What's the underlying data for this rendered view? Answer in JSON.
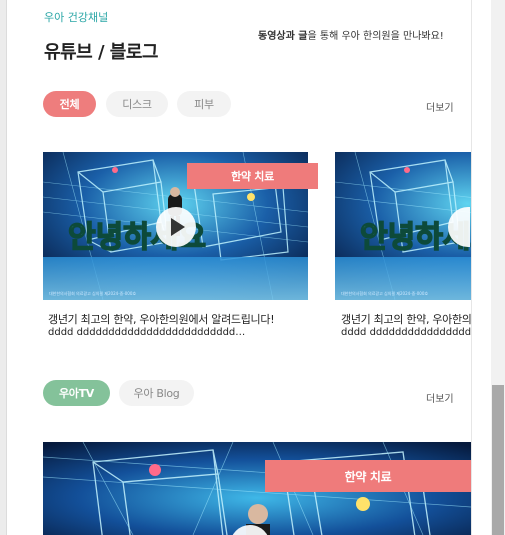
{
  "section": {
    "eyebrow": "우아 건강채널",
    "title": "유튜브 / 블로그",
    "description_bold": "동영상과 글",
    "description_rest": "을 통해 우아 한의원을 만나봐요!"
  },
  "video_filters": {
    "tabs": [
      {
        "label": "전체",
        "active": true
      },
      {
        "label": "디스크",
        "active": false
      },
      {
        "label": "피부",
        "active": false
      }
    ],
    "more_label": "더보기"
  },
  "video_cards": [
    {
      "badge": "한약 치료",
      "overlay_text": "안녕하세요",
      "title": "갱년기 최고의 한약, 우아한의원에서 알려드립니다!",
      "subtitle": "dddd ddddddddddddddddddddddddd…"
    },
    {
      "overlay_text": "안녕하세요",
      "title": "갱년기 최고의 한약, 우아한의원에서 알려드립니다!",
      "subtitle": "dddd ddddddddddddddddddddddddd…"
    }
  ],
  "channel_tabs": {
    "tabs": [
      {
        "label": "우아TV",
        "active": true
      },
      {
        "label": "우아 Blog",
        "active": false
      }
    ],
    "more_label": "더보기"
  },
  "featured_card": {
    "badge": "한약 치료"
  },
  "colors": {
    "accent_red": "#ee7d7d",
    "accent_green": "#84c29a",
    "eyebrow_teal": "#2aa6a6"
  }
}
